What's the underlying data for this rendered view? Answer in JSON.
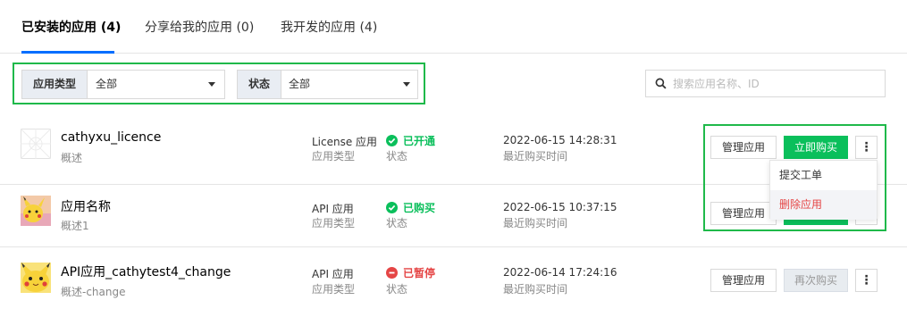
{
  "tabs": [
    {
      "label": "已安装的应用 (4)",
      "active": true
    },
    {
      "label": "分享给我的应用 (0)",
      "active": false
    },
    {
      "label": "我开发的应用 (4)",
      "active": false
    }
  ],
  "filters": {
    "type": {
      "label": "应用类型",
      "value": "全部"
    },
    "status": {
      "label": "状态",
      "value": "全部"
    }
  },
  "search": {
    "placeholder": "搜索应用名称、ID"
  },
  "rows": [
    {
      "name": "cathyxu_licence",
      "desc": "概述",
      "type_value": "License 应用",
      "type_label": "应用类型",
      "status": "已开通",
      "status_label": "状态",
      "time": "2022-06-15 14:28:31",
      "time_label": "最近购买时间",
      "manage": "管理应用",
      "buy": "立即购买"
    },
    {
      "name": "应用名称",
      "desc": "概述1",
      "type_value": "API 应用",
      "type_label": "应用类型",
      "status": "已购买",
      "status_label": "状态",
      "time": "2022-06-15 10:37:15",
      "time_label": "最近购买时间",
      "manage": "管理应用"
    },
    {
      "name": "API应用_cathytest4_change",
      "desc": "概述-change",
      "type_value": "API 应用",
      "type_label": "应用类型",
      "status": "已暂停",
      "status_label": "状态",
      "time": "2022-06-14 17:24:16",
      "time_label": "最近购买时间",
      "manage": "管理应用",
      "buy": "再次购买"
    }
  ],
  "more_menu": {
    "items": [
      "提交工单",
      "删除应用"
    ]
  },
  "colors": {
    "primary": "#0abf5b",
    "success": "#0abf5b",
    "danger": "#e54545",
    "highlight_box": "#1fb94a",
    "tab_underline": "#006eff"
  }
}
